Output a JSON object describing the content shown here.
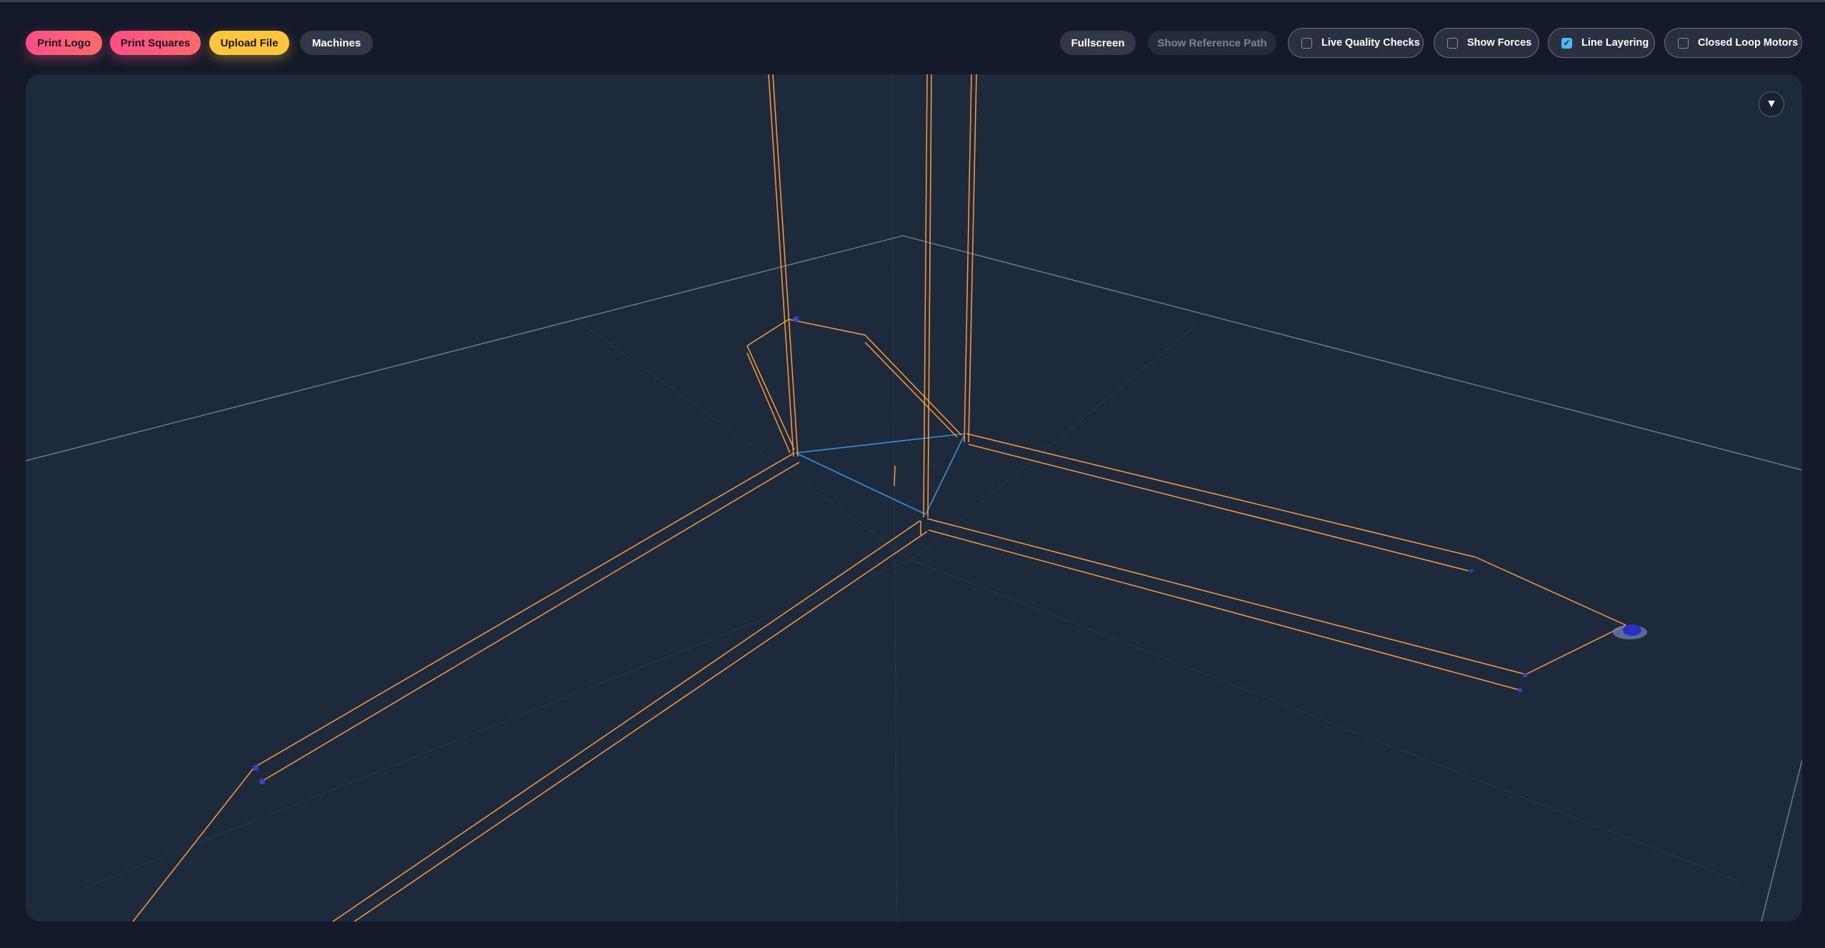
{
  "toolbar": {
    "print_logo": "Print Logo",
    "print_squares": "Print Squares",
    "upload_file": "Upload File",
    "machines": "Machines",
    "fullscreen": "Fullscreen",
    "show_reference_path": "Show Reference Path"
  },
  "toggles": [
    {
      "label": "Live Quality Checks",
      "checked": false
    },
    {
      "label": "Show Forces",
      "checked": false
    },
    {
      "label": "Line Layering",
      "checked": true
    },
    {
      "label": "Closed Loop Motors",
      "checked": false
    }
  ],
  "viewport": {
    "menu_icon": "triangle-down-icon",
    "menu_glyph": "▼"
  },
  "colors": {
    "background": "#151a2a",
    "viewport": "#1c2a3b",
    "toolpath": "#ff9a3c",
    "travel_path": "#3a8fd6",
    "accent_checkbox": "#4fb8f0"
  }
}
